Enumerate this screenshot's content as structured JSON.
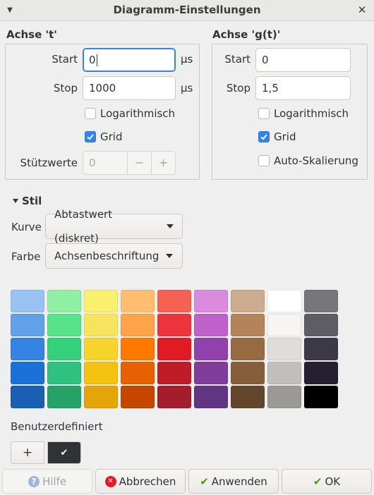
{
  "window": {
    "title": "Diagramm-Einstellungen",
    "menu_glyph": "▼",
    "close_glyph": "✕"
  },
  "axis_t": {
    "title": "Achse 't'",
    "start_label": "Start",
    "start_value": "0",
    "start_unit": "μs",
    "stop_label": "Stop",
    "stop_value": "1000",
    "stop_unit": "μs",
    "logarithmic_label": "Logarithmisch",
    "logarithmic_checked": false,
    "grid_label": "Grid",
    "grid_checked": true,
    "samples_label": "Stützwerte",
    "samples_value": "0",
    "minus": "−",
    "plus": "+"
  },
  "axis_g": {
    "title": "Achse 'g(t)'",
    "start_label": "Start",
    "start_value": "0",
    "stop_label": "Stop",
    "stop_value": "1,5",
    "logarithmic_label": "Logarithmisch",
    "logarithmic_checked": false,
    "grid_label": "Grid",
    "grid_checked": true,
    "autoscale_label": "Auto-Skalierung",
    "autoscale_checked": false
  },
  "style": {
    "expander_label": "Stil",
    "curve_label": "Kurve",
    "curve_value": "Abtastwert (diskret)",
    "color_label": "Farbe",
    "color_value": "Achsenbeschriftung"
  },
  "palette": {
    "columns": [
      [
        "#99c1f1",
        "#62a0ea",
        "#3584e4",
        "#1c71d8",
        "#1a5fb4"
      ],
      [
        "#8ff0a4",
        "#57e389",
        "#33d17a",
        "#2ec27e",
        "#26a269"
      ],
      [
        "#f9f06b",
        "#f8e45c",
        "#f6d32d",
        "#f5c211",
        "#e5a50a"
      ],
      [
        "#ffbe6f",
        "#ffa348",
        "#ff7800",
        "#e66100",
        "#c64600"
      ],
      [
        "#f66151",
        "#ed333b",
        "#e01b24",
        "#c01c28",
        "#a51d2d"
      ],
      [
        "#dc8add",
        "#c061cb",
        "#9141ac",
        "#813d9c",
        "#613583"
      ],
      [
        "#cdab8f",
        "#b5835a",
        "#986a44",
        "#865e3c",
        "#63452c"
      ],
      [
        "#ffffff",
        "#f6f5f4",
        "#deddda",
        "#c0bfbc",
        "#9a9996"
      ],
      [
        "#77767b",
        "#5e5c64",
        "#3d3846",
        "#241f31",
        "#000000"
      ]
    ],
    "custom_label": "Benutzerdefiniert",
    "add_glyph": "+",
    "selected_glyph": "✔",
    "selected_color": "#2e3436"
  },
  "buttons": {
    "help": "Hilfe",
    "help_icon": "?",
    "cancel": "Abbrechen",
    "cancel_icon": "✕",
    "apply": "Anwenden",
    "apply_icon": "✔",
    "ok": "OK",
    "ok_icon": "✔"
  }
}
